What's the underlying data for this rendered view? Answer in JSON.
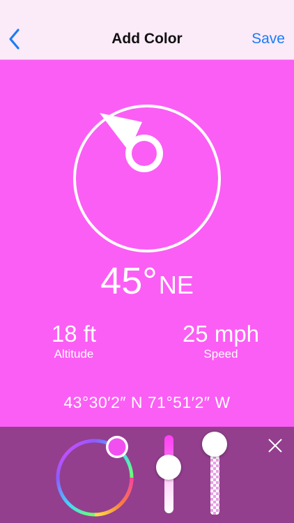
{
  "nav": {
    "title": "Add Color",
    "save_label": "Save",
    "back_icon": "chevron-left-icon",
    "accent_color": "#1a7cf5"
  },
  "compass": {
    "heading_degrees": "45°",
    "direction": "NE",
    "icon": "compass-needle-icon"
  },
  "stats": {
    "altitude_value": "18 ft",
    "altitude_label": "Altitude",
    "speed_value": "25 mph",
    "speed_label": "Speed"
  },
  "coordinates": "43°30′2″ N  71°51′2″ W",
  "colors": {
    "background": "#fb5ef4",
    "toolbar": "#933f8e",
    "nav_bar": "#fbeaf8"
  },
  "color_picker": {
    "selected_color": "#f24ff0",
    "brightness_level": 0.25,
    "opacity_level": 1.0,
    "close_icon": "close-icon"
  }
}
